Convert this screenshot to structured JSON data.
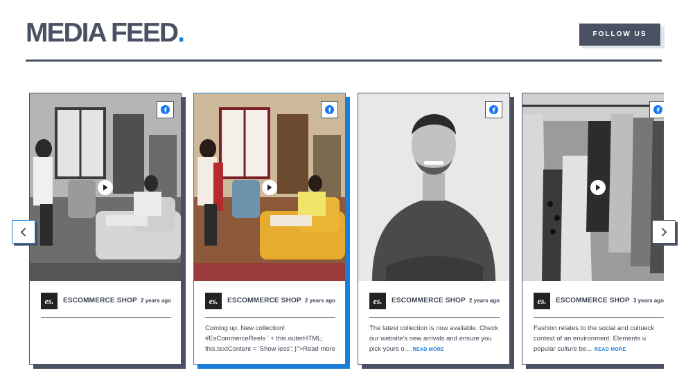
{
  "header": {
    "title": "MEDIA FEED",
    "title_dot": ".",
    "follow_label": "FOLLOW US"
  },
  "colors": {
    "accent": "#1a7fd9",
    "dark": "#4a5162"
  },
  "posts": [
    {
      "shop": "ESCOMMERCE SHOP",
      "logo": "es.",
      "time": "2 years ago",
      "text": "",
      "more": "",
      "media": "video",
      "grayscale": true,
      "active": false
    },
    {
      "shop": "ESCOMMERCE SHOP",
      "logo": "es.",
      "time": "2 years ago",
      "text": "Coming up. New collection! #EsCommerceReels ' + this.outerHTML; this.textContent = 'Show less'; }\">Read more",
      "more": "",
      "media": "video",
      "grayscale": false,
      "active": true
    },
    {
      "shop": "ESCOMMERCE SHOP",
      "logo": "es.",
      "time": "2 years ago",
      "text": "The latest collection is now available. Check our website's new arrivals and ensure you pick yours o...",
      "more": "READ MORE",
      "media": "image",
      "grayscale": true,
      "active": false
    },
    {
      "shop": "ESCOMMERCE SHOP",
      "logo": "es.",
      "time": "3 years ago",
      "text": "Fashion relates to the social and cultueck context of an environment. Elements u popular culture be...",
      "more": "READ MORE",
      "media": "video",
      "grayscale": true,
      "active": false
    }
  ],
  "icons": {
    "platform": "facebook-icon",
    "play": "play-icon",
    "prev": "chevron-left-icon",
    "next": "chevron-right-icon"
  }
}
